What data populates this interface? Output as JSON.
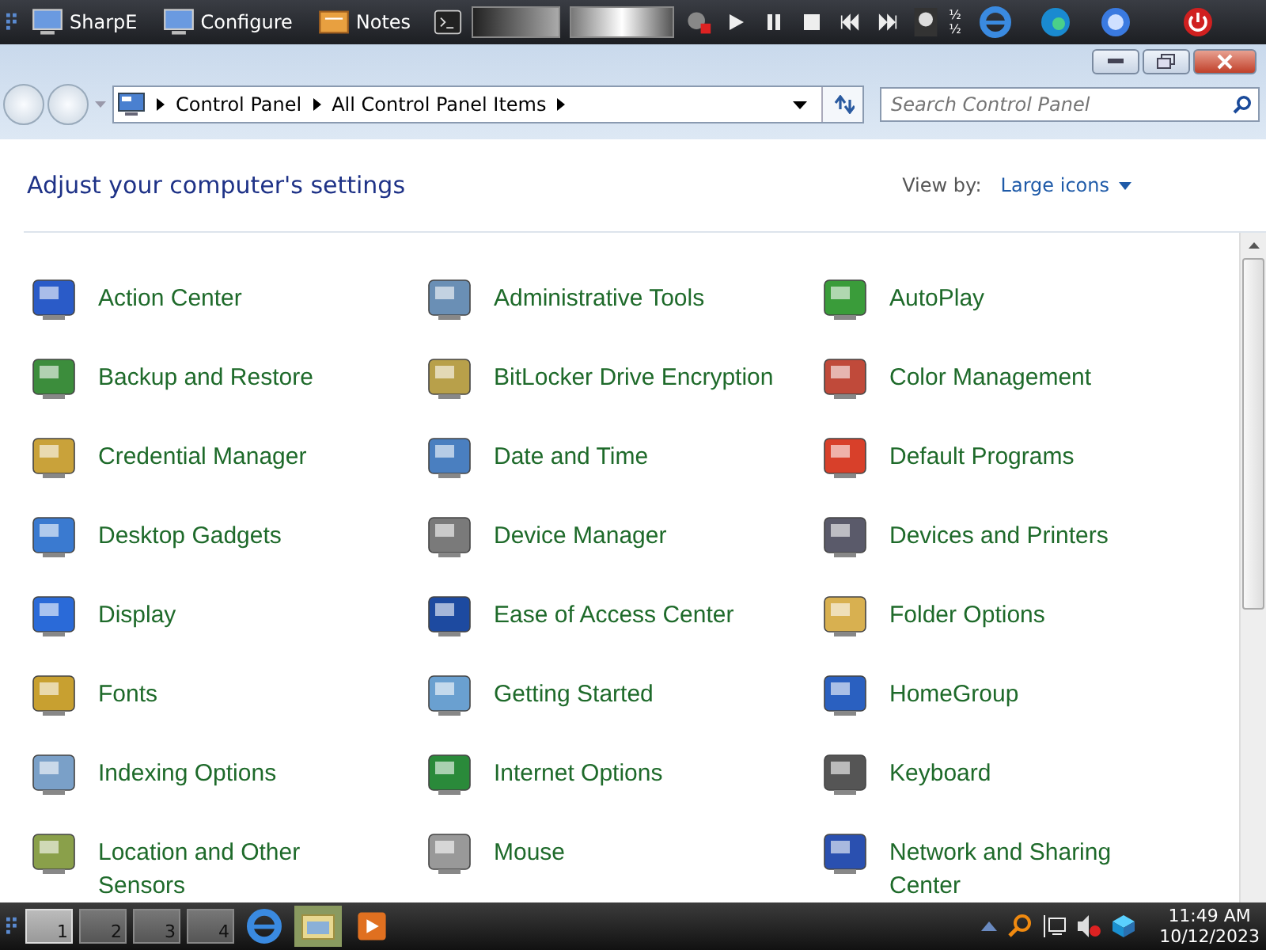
{
  "top_bar": {
    "launchers": [
      {
        "label": "SharpE",
        "kind": "monitor"
      },
      {
        "label": "Configure",
        "kind": "monitor"
      },
      {
        "label": "Notes",
        "kind": "notes"
      }
    ],
    "fractions": [
      "½",
      "½"
    ]
  },
  "window": {
    "breadcrumb": [
      "Control Panel",
      "All Control Panel Items"
    ],
    "search": {
      "placeholder": "Search Control Panel"
    }
  },
  "header": {
    "title": "Adjust your computer's settings",
    "view_by_label": "View by:",
    "view_by_value": "Large icons"
  },
  "items": [
    {
      "label": "Action Center"
    },
    {
      "label": "Administrative Tools"
    },
    {
      "label": "AutoPlay"
    },
    {
      "label": "Backup and Restore"
    },
    {
      "label": "BitLocker Drive Encryption"
    },
    {
      "label": "Color Management"
    },
    {
      "label": "Credential Manager"
    },
    {
      "label": "Date and Time"
    },
    {
      "label": "Default Programs"
    },
    {
      "label": "Desktop Gadgets"
    },
    {
      "label": "Device Manager"
    },
    {
      "label": "Devices and Printers"
    },
    {
      "label": "Display"
    },
    {
      "label": "Ease of Access Center"
    },
    {
      "label": "Folder Options"
    },
    {
      "label": "Fonts"
    },
    {
      "label": "Getting Started"
    },
    {
      "label": "HomeGroup"
    },
    {
      "label": "Indexing Options"
    },
    {
      "label": "Internet Options"
    },
    {
      "label": "Keyboard"
    },
    {
      "label": "Location and Other Sensors"
    },
    {
      "label": "Mouse"
    },
    {
      "label": "Network and Sharing Center"
    }
  ],
  "taskbar": {
    "workspaces": [
      {
        "label": "1",
        "selected": true
      },
      {
        "label": "2",
        "selected": false
      },
      {
        "label": "3",
        "selected": false
      },
      {
        "label": "4",
        "selected": false
      }
    ],
    "time": "11:49 AM",
    "date": "10/12/2023"
  }
}
